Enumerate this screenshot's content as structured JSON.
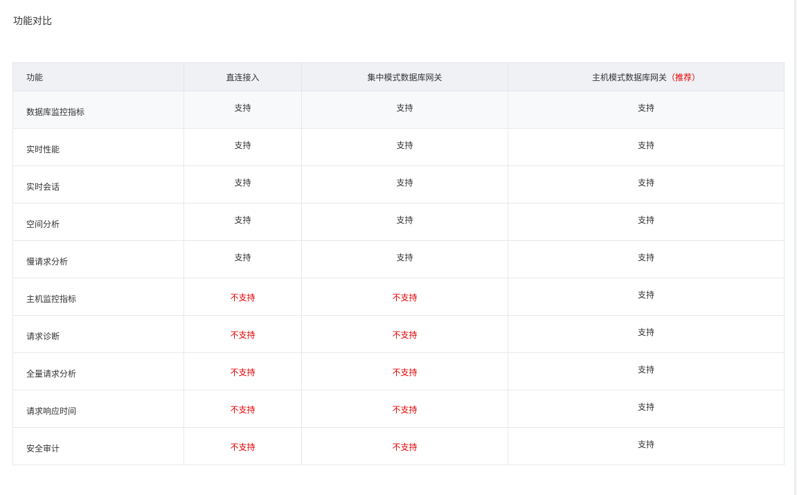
{
  "page": {
    "title": "功能对比"
  },
  "colors": {
    "unsupported": "#e60000",
    "header_bg": "#eff1f5",
    "border": "#e6e8eb"
  },
  "table": {
    "headers": [
      "功能",
      "直连接入",
      "集中模式数据库网关",
      "主机模式数据库网关"
    ],
    "recommended_tag": "（推荐）",
    "rows": [
      {
        "feature": "数据库监控指标",
        "direct": "支持",
        "centralized": "支持",
        "host": "支持"
      },
      {
        "feature": "实时性能",
        "direct": "支持",
        "centralized": "支持",
        "host": "支持"
      },
      {
        "feature": "实时会话",
        "direct": "支持",
        "centralized": "支持",
        "host": "支持"
      },
      {
        "feature": "空间分析",
        "direct": "支持",
        "centralized": "支持",
        "host": "支持"
      },
      {
        "feature": "慢请求分析",
        "direct": "支持",
        "centralized": "支持",
        "host": "支持"
      },
      {
        "feature": "主机监控指标",
        "direct": "不支持",
        "centralized": "不支持",
        "host": "支持"
      },
      {
        "feature": "请求诊断",
        "direct": "不支持",
        "centralized": "不支持",
        "host": "支持"
      },
      {
        "feature": "全量请求分析",
        "direct": "不支持",
        "centralized": "不支持",
        "host": "支持"
      },
      {
        "feature": "请求响应时间",
        "direct": "不支持",
        "centralized": "不支持",
        "host": "支持"
      },
      {
        "feature": "安全审计",
        "direct": "不支持",
        "centralized": "不支持",
        "host": "支持"
      }
    ]
  }
}
